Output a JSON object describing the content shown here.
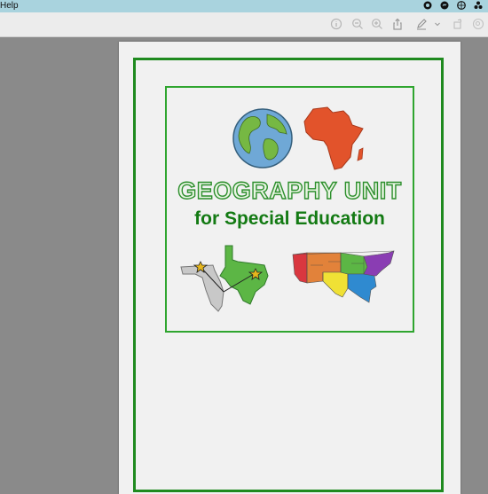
{
  "menubar": {
    "help_label": "Help"
  },
  "icons": {
    "tray": [
      "status-icon",
      "messenger-icon",
      "vpn-icon",
      "control-center-icon"
    ],
    "toolbar": [
      "info-icon",
      "zoom-out-icon",
      "zoom-in-icon",
      "share-icon",
      "markup-pen-icon",
      "markup-dropdown-icon",
      "rotate-icon",
      "search-icon"
    ]
  },
  "document": {
    "title": "GEOGRAPHY UNIT",
    "subtitle": "for Special Education"
  },
  "colors": {
    "accent_green": "#1f8a1f",
    "africa_orange": "#e2532b",
    "texas_green": "#5cb645",
    "florida_gray": "#bdbdbd"
  }
}
